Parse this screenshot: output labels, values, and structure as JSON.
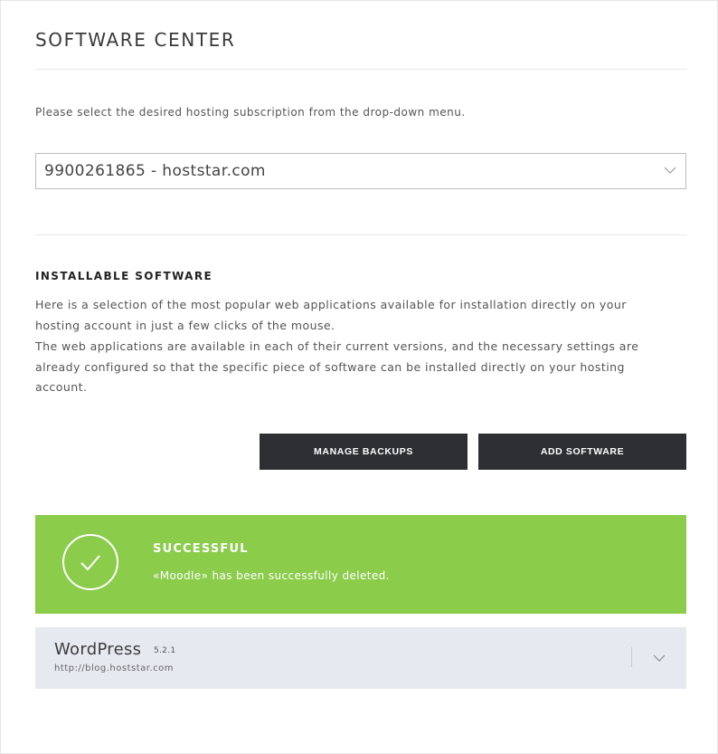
{
  "page": {
    "title": "SOFTWARE CENTER",
    "intro": "Please select the desired hosting subscription from the drop-down menu."
  },
  "subscription_select": {
    "value": "9900261865 - hoststar.com",
    "icon": "chevron-down-icon"
  },
  "installable": {
    "heading": "INSTALLABLE SOFTWARE",
    "paragraph_1": "Here is a selection of the most popular web applications available for installation directly on your hosting account in just a few clicks of the mouse.",
    "paragraph_2": "The web applications are available in each of their current versions, and the necessary settings are already configured so that the specific piece of software can be installed directly on your hosting account."
  },
  "actions": {
    "manage_backups_label": "MANAGE BACKUPS",
    "add_software_label": "ADD SOFTWARE"
  },
  "alert": {
    "title": "SUCCESSFUL",
    "message": "«Moodle» has been successfully deleted.",
    "icon": "checkmark-circle-icon",
    "color": "#8bcc4b"
  },
  "installed_apps": [
    {
      "name": "WordPress",
      "version": "5.2.1",
      "url": "http://blog.hoststar.com",
      "icon": "chevron-down-icon"
    }
  ],
  "colors": {
    "button_bg": "#2e2f33",
    "success_green": "#8bcc4b",
    "app_row_bg": "#e7e9f1"
  }
}
